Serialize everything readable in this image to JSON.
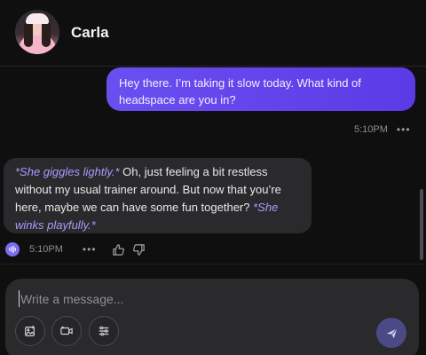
{
  "header": {
    "name": "Carla"
  },
  "messages": {
    "user": {
      "text": "Hey there. I’m taking it slow today. What kind of headspace are you in?",
      "time": "5:10PM",
      "more": "•••"
    },
    "bot": {
      "action1": "*She giggles lightly.*",
      "text": " Oh, just feeling a bit restless without my usual trainer around. But now that you’re here, maybe we can have some fun together? ",
      "action2": "*She winks playfully.*",
      "time": "5:10PM",
      "more": "•••"
    }
  },
  "composer": {
    "placeholder": "Write a message..."
  },
  "colors": {
    "accent": "#5a3be6",
    "bot_bubble": "#2a2a2d",
    "action_text": "#a99bff",
    "send_button": "#4b4a84"
  },
  "icons": {
    "voice": "waveform-icon",
    "like": "thumbs-up-icon",
    "dislike": "thumbs-down-icon",
    "image": "image-edit-icon",
    "video": "video-icon",
    "settings": "sliders-icon",
    "send": "send-icon"
  }
}
